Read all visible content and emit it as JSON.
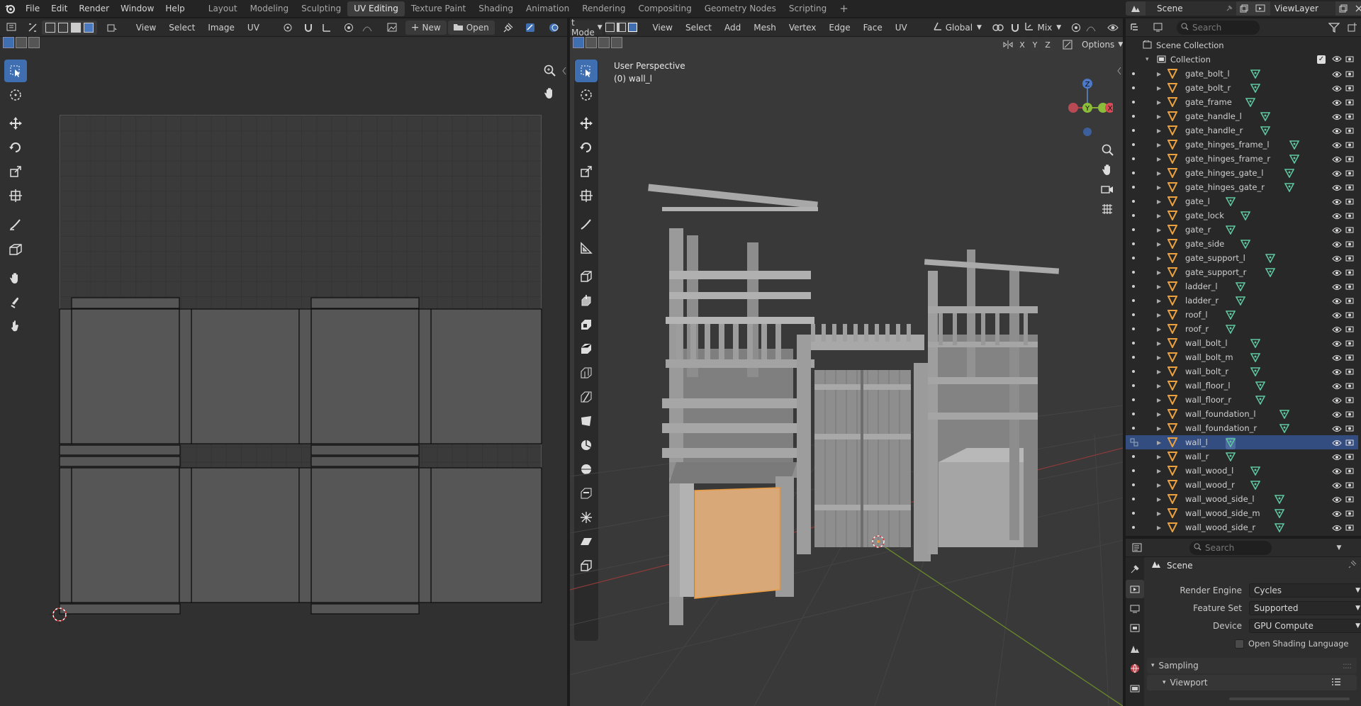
{
  "topbar": {
    "menus": [
      "File",
      "Edit",
      "Render",
      "Window",
      "Help"
    ],
    "workspaces": [
      "Layout",
      "Modeling",
      "Sculpting",
      "UV Editing",
      "Texture Paint",
      "Shading",
      "Animation",
      "Rendering",
      "Compositing",
      "Geometry Nodes",
      "Scripting"
    ],
    "active_workspace": "UV Editing",
    "add_tab": "+",
    "scene_name": "Scene",
    "viewlayer_name": "ViewLayer"
  },
  "uv_editor": {
    "menus": [
      "View",
      "Select",
      "Image",
      "UV"
    ],
    "new_label": "New",
    "open_label": "Open"
  },
  "viewport": {
    "mode": "t Mode",
    "menus": [
      "View",
      "Select",
      "Add",
      "Mesh",
      "Vertex",
      "Edge",
      "Face",
      "UV"
    ],
    "orientation": "Global",
    "snap_mode": "Mix",
    "axis_x": "X",
    "axis_y": "Y",
    "axis_z": "Z",
    "options_label": "Options",
    "perspective_label": "User Perspective",
    "object_label": "(0) wall_l",
    "gizmo_z": "Z",
    "gizmo_y": "Y",
    "gizmo_x": "X"
  },
  "outliner": {
    "search_placeholder": "Search",
    "scene_collection": "Scene Collection",
    "collection": "Collection",
    "items": [
      "gate_bolt_l",
      "gate_bolt_r",
      "gate_frame",
      "gate_handle_l",
      "gate_handle_r",
      "gate_hinges_frame_l",
      "gate_hinges_frame_r",
      "gate_hinges_gate_l",
      "gate_hinges_gate_r",
      "gate_l",
      "gate_lock",
      "gate_r",
      "gate_side",
      "gate_support_l",
      "gate_support_r",
      "ladder_l",
      "ladder_r",
      "roof_l",
      "roof_r",
      "wall_bolt_l",
      "wall_bolt_m",
      "wall_bolt_r",
      "wall_floor_l",
      "wall_floor_r",
      "wall_foundation_l",
      "wall_foundation_r",
      "wall_l",
      "wall_r",
      "wall_wood_l",
      "wall_wood_r",
      "wall_wood_side_l",
      "wall_wood_side_m",
      "wall_wood_side_r"
    ],
    "selected": "wall_l"
  },
  "properties": {
    "search_placeholder": "Search",
    "scene_title": "Scene",
    "render_engine_label": "Render Engine",
    "render_engine_value": "Cycles",
    "feature_set_label": "Feature Set",
    "feature_set_value": "Supported",
    "device_label": "Device",
    "device_value": "GPU Compute",
    "osl_label": "Open Shading Language",
    "sampling_label": "Sampling",
    "viewport_label": "Viewport"
  },
  "colors": {
    "accent": "#3f6fb0",
    "selection": "#334d80",
    "selected_face": "#d8a878",
    "mesh_icon": "#e8a040",
    "data_icon": "#5fc6a0"
  }
}
